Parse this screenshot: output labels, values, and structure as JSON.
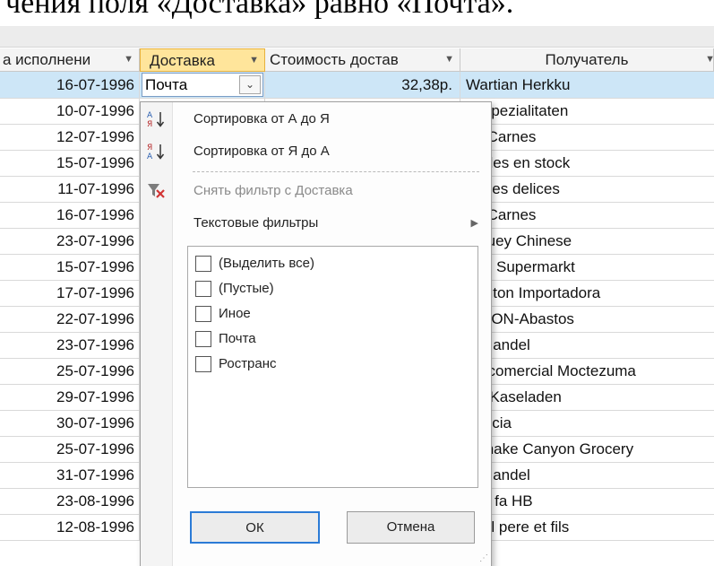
{
  "caption": "чения поля «Доставка» равно «Почта».",
  "columns": [
    {
      "label": "а исполнени"
    },
    {
      "label": "Доставка"
    },
    {
      "label": "Стоимость достав"
    },
    {
      "label": "Получатель"
    }
  ],
  "rows": [
    {
      "date": "16-07-1996",
      "ship": "Почта",
      "cost": "32,38р.",
      "rcpt": "Wartian Herkku"
    },
    {
      "date": "10-07-1996",
      "rcpt": "is Spezialitaten"
    },
    {
      "date": "12-07-1996",
      "rcpt": "ari Carnes"
    },
    {
      "date": "15-07-1996",
      "rcpt": "uailles en stock"
    },
    {
      "date": "11-07-1996",
      "rcpt": "remes delices"
    },
    {
      "date": "16-07-1996",
      "rcpt": "ari Carnes"
    },
    {
      "date": "23-07-1996",
      "rcpt": "p-suey Chinese"
    },
    {
      "date": "15-07-1996",
      "rcpt": "nter Supermarkt"
    },
    {
      "date": "17-07-1996",
      "rcpt": "llington Importadora"
    },
    {
      "date": "22-07-1996",
      "rcpt": "ARION-Abastos"
    },
    {
      "date": "23-07-1996",
      "rcpt": "st Handel"
    },
    {
      "date": "25-07-1996",
      "rcpt": "tro comercial Moctezuma"
    },
    {
      "date": "29-07-1996",
      "rcpt": "ies Kaseladen"
    },
    {
      "date": "30-07-1996",
      "rcpt": "Delicia"
    },
    {
      "date": "25-07-1996",
      "rcpt": "lesnake Canyon Grocery"
    },
    {
      "date": "31-07-1996",
      "rcpt": "st Handel"
    },
    {
      "date": "23-08-1996",
      "rcpt": "och fa HB"
    },
    {
      "date": "12-08-1996",
      "rcpt": "ndel pere et fils"
    }
  ],
  "menu": {
    "sort_asc": "Сортировка от А до Я",
    "sort_desc": "Сортировка от Я до А",
    "clear_filter": "Снять фильтр с Доставка",
    "text_filters": "Текстовые фильтры",
    "options": [
      "(Выделить все)",
      "(Пустые)",
      "Иное",
      "Почта",
      "Ространс"
    ],
    "ok": "ОК",
    "cancel": "Отмена"
  },
  "colors": {
    "active_header": "#ffe59b",
    "selected_row": "#cde6f7",
    "ok_border": "#2b7bd6"
  }
}
